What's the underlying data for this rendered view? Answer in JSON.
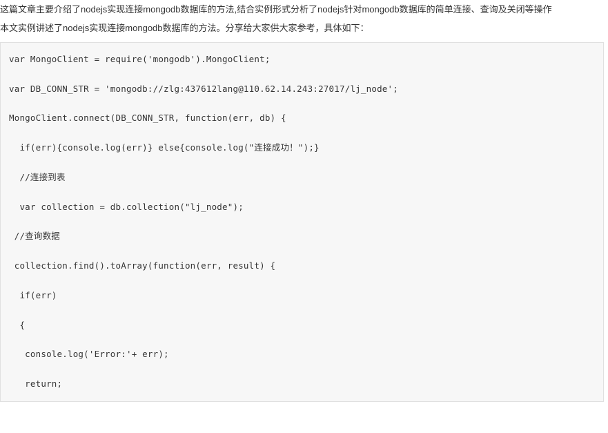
{
  "intro": {
    "line1": "这篇文章主要介绍了nodejs实现连接mongodb数据库的方法,结合实例形式分析了nodejs针对mongodb数据库的简单连接、查询及关闭等操作",
    "line2": "本文实例讲述了nodejs实现连接mongodb数据库的方法。分享给大家供大家参考，具体如下："
  },
  "code": [
    "var MongoClient = require('mongodb').MongoClient;",
    "",
    "var DB_CONN_STR = 'mongodb://zlg:437612lang@110.62.14.243:27017/lj_node';",
    "",
    "MongoClient.connect(DB_CONN_STR, function(err, db) {",
    "",
    "  if(err){console.log(err)} else{console.log(\"连接成功！\");}",
    "",
    "  //连接到表",
    "",
    "  var collection = db.collection(\"lj_node\");",
    "",
    " //查询数据",
    "",
    " collection.find().toArray(function(err, result) {",
    "",
    "  if(err)",
    "",
    "  {",
    "",
    "   console.log('Error:'+ err);",
    "",
    "   return;"
  ]
}
